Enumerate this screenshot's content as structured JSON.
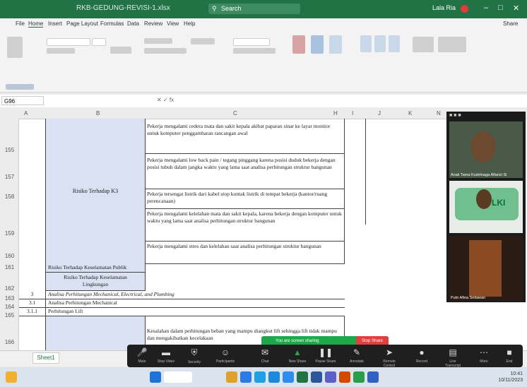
{
  "titlebar": {
    "doc_title": "RKB-GEDUNG-REVISI-1.xlsx",
    "search_placeholder": "Search",
    "user": "Lala Ria"
  },
  "menu": [
    "File",
    "Home",
    "Insert",
    "Page Layout",
    "Formulas",
    "Data",
    "Review",
    "View",
    "Help"
  ],
  "share_label": "Share",
  "namebox": "G96",
  "columns": [
    "A",
    "B",
    "C",
    "H",
    "I",
    "J",
    "K",
    "N"
  ],
  "rows": [
    {
      "num": "155",
      "c": "Pekerja mengalami cedera mata dan sakit kepala akibat paparan sinar ke layar monitor untuk komputer penggambaran rancangan awal"
    },
    {
      "num": "157",
      "c": "Pekerja mengalami low back pain / tegang pinggang karena posisi duduk bekerja dengan posisi tubuh dalam jangka waktu yang lama saat analisa perhitungan struktur bangunan"
    },
    {
      "num": "158",
      "c": "Pekerja tersengat listrik dari kabel stop kontak listrik di tempat bekerja (kantor/ruang perencanaan)"
    },
    {
      "num": "159",
      "c": "Pekerja mengalami kelelahan mata dan sakit kepala, karena bekerja dengan komputer untuk waktu yang lama saat analisa perhitungan struktur bangunan"
    },
    {
      "num": "160",
      "c": "Pekerja mengalami stres dan kelelahan saat analisa perhitungan struktur bangunan"
    }
  ],
  "risk_k3_label": "Risiko Terhadap K3",
  "row161": {
    "num": "161",
    "b": "Risiko Terhadap Keselamatan Publik"
  },
  "row162": {
    "num": "162",
    "b": "Risiko Terhadap Keselamatan Lingkungan"
  },
  "row163": {
    "num": "163",
    "a": "3",
    "b": "Analisa Perhitungan Mechanical, Electrical, and Plumbing"
  },
  "row164": {
    "num": "164",
    "a": "3.1",
    "b": "Analisa Perhitungan Mechanical"
  },
  "row165": {
    "num": "165",
    "a": "3.1.1",
    "b": "Perhitungan Lift"
  },
  "row166": {
    "num": "166",
    "c": "Kesalahan dalam perhitungan beban yang mampu diangkut lift sehingga lift tidak mampu dan mengakibatkan kecelakaan"
  },
  "sheet_tab": "Sheet1",
  "video": [
    {
      "name": "Anak Tama Kustrinaga Alfarizi Si"
    },
    {
      "name": "LKI"
    },
    {
      "name": "Putri Afina Setiawan"
    }
  ],
  "sharing_text": "You are screen sharing",
  "stop_share": "Stop Share",
  "meeting_buttons": [
    "Mute",
    "Stop Video",
    "Security",
    "Participants",
    "Chat",
    "New Share",
    "Pause Share",
    "Annotate",
    "Remote Control",
    "Record",
    "Live Transcript",
    "More",
    "End"
  ],
  "clock": {
    "time": "10:41",
    "date": "10/11/2023"
  },
  "colors": {
    "excel_green": "#217346",
    "risk_fill": "#d9e1f2",
    "share_green": "#1fa84a",
    "stop_red": "#e33e3e"
  }
}
